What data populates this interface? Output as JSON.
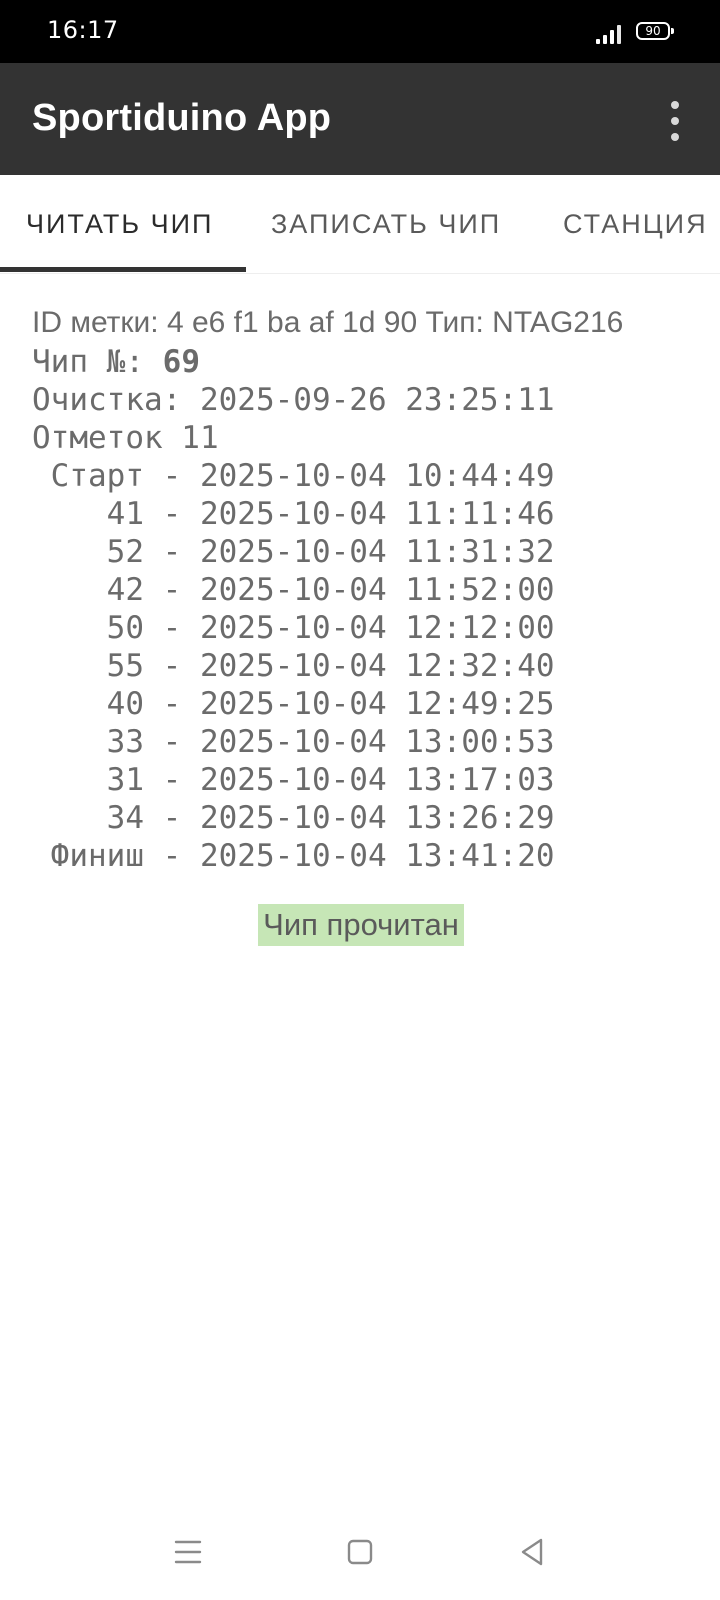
{
  "status_bar": {
    "time": "16:17",
    "battery": "90"
  },
  "app_bar": {
    "title": "Sportiduino App",
    "menu_icon": "more-vert-icon"
  },
  "tabs": [
    {
      "label": "ЧИТАТЬ ЧИП",
      "active": true
    },
    {
      "label": "ЗАПИСАТЬ ЧИП",
      "active": false
    },
    {
      "label": "СТАНЦИЯ",
      "active": false
    }
  ],
  "chip": {
    "id_line": "ID метки: 4 e6 f1 ba af 1d 90   Тип: NTAG216",
    "number_label": "Чип №: ",
    "number_value": "69",
    "clear_line": "Очистка: 2025-09-26 23:25:11",
    "marks_line": "Отметок 11",
    "marks": [
      " Старт - 2025-10-04 10:44:49",
      "    41 - 2025-10-04 11:11:46",
      "    52 - 2025-10-04 11:31:32",
      "    42 - 2025-10-04 11:52:00",
      "    50 - 2025-10-04 12:12:00",
      "    55 - 2025-10-04 12:32:40",
      "    40 - 2025-10-04 12:49:25",
      "    33 - 2025-10-04 13:00:53",
      "    31 - 2025-10-04 13:17:03",
      "    34 - 2025-10-04 13:26:29",
      " Финиш - 2025-10-04 13:41:20"
    ],
    "status": "Чип прочитан",
    "status_color": "#c6e6b6"
  },
  "nav_bar": {
    "menu_icon": "menu-icon",
    "home_icon": "home-icon",
    "back_icon": "back-icon"
  }
}
